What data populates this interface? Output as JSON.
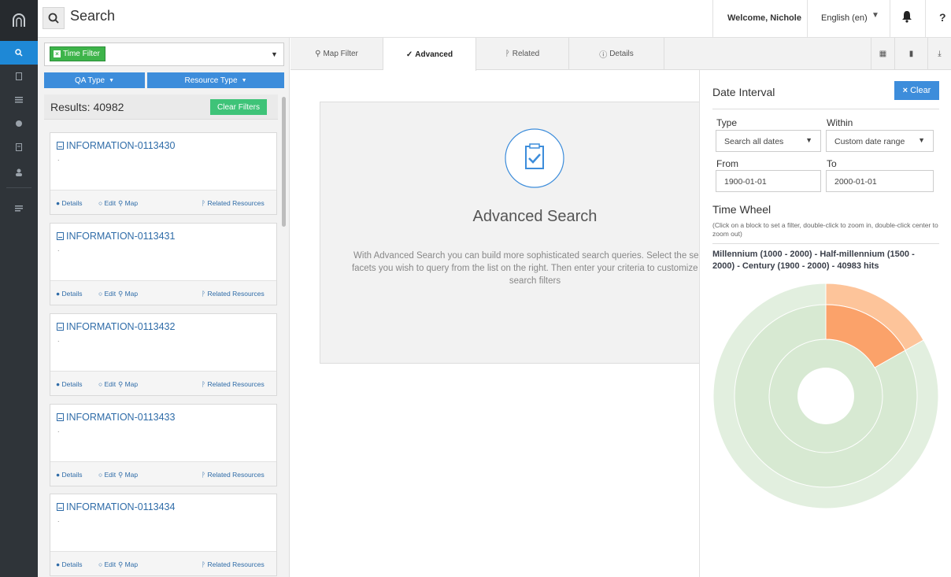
{
  "header": {
    "title": "Search",
    "welcome": "Welcome, Nichole",
    "language": "English (en)",
    "help": "?"
  },
  "filter": {
    "time_filter_label": "Time Filter",
    "qa_type": "QA Type",
    "resource_type": "Resource Type"
  },
  "results": {
    "count_label": "Results: 40982",
    "clear_filters": "Clear Filters",
    "cards": [
      {
        "title": "INFORMATION-0113430",
        "dot": ".",
        "details": "Details",
        "edit": "Edit",
        "map": "Map",
        "related": "Related Resources"
      },
      {
        "title": "INFORMATION-0113431",
        "dot": ".",
        "details": "Details",
        "edit": "Edit",
        "map": "Map",
        "related": "Related Resources"
      },
      {
        "title": "INFORMATION-0113432",
        "dot": ".",
        "details": "Details",
        "edit": "Edit",
        "map": "Map",
        "related": "Related Resources"
      },
      {
        "title": "INFORMATION-0113433",
        "dot": ".",
        "details": "Details",
        "edit": "Edit",
        "map": "Map",
        "related": "Related Resources"
      },
      {
        "title": "INFORMATION-0113434",
        "dot": ".",
        "details": "Details",
        "edit": "Edit",
        "map": "Map",
        "related": "Related Resources"
      }
    ]
  },
  "tabs": [
    {
      "label": "Map Filter"
    },
    {
      "label": "Advanced"
    },
    {
      "label": "Related"
    },
    {
      "label": "Details"
    }
  ],
  "advanced": {
    "title": "Advanced Search",
    "description": "With Advanced Search you can build more sophisticated search queries. Select the search facets you wish to query from the list on the right. Then enter your criteria to customize your search filters"
  },
  "date_interval": {
    "title": "Date Interval",
    "clear": "Clear",
    "type_label": "Type",
    "type_value": "Search all dates",
    "within_label": "Within",
    "within_value": "Custom date range",
    "from_label": "From",
    "from_value": "1900-01-01",
    "to_label": "To",
    "to_value": "2000-01-01"
  },
  "time_wheel": {
    "title": "Time Wheel",
    "hint": "(Click on a block to set a filter, double-click to zoom in, double-click center to zoom out)",
    "path": "Millennium (1000 - 2000) - Half-millennium (1500 - 2000) - Century (1900 - 2000) - 40983 hits",
    "colors": {
      "base": "#e2efdf",
      "mid": "#d7e9d2",
      "highlight_outer": "#fdc49a",
      "highlight_inner": "#fba26a"
    }
  }
}
